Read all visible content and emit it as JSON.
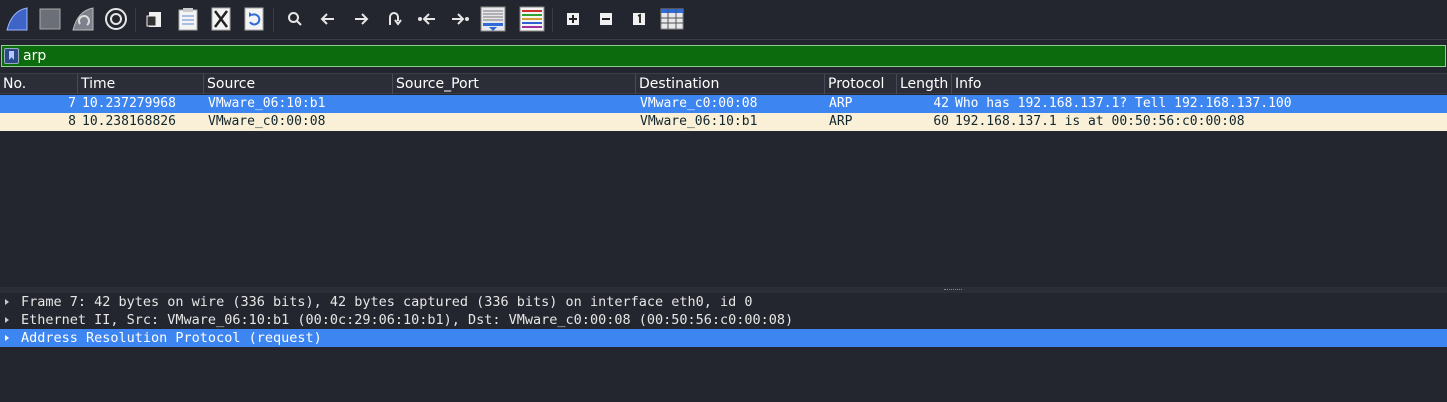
{
  "toolbar": {
    "buttons": [
      {
        "name": "start-capture-icon"
      },
      {
        "name": "stop-capture-icon"
      },
      {
        "name": "restart-capture-icon"
      },
      {
        "name": "capture-options-icon"
      },
      {
        "name": "open-file-icon"
      },
      {
        "name": "save-file-icon"
      },
      {
        "name": "close-file-icon"
      },
      {
        "name": "reload-file-icon"
      },
      {
        "name": "find-packet-icon"
      },
      {
        "name": "go-back-icon"
      },
      {
        "name": "go-forward-icon"
      },
      {
        "name": "go-to-packet-icon"
      },
      {
        "name": "go-first-packet-icon"
      },
      {
        "name": "go-last-packet-icon"
      },
      {
        "name": "autoscroll-icon"
      },
      {
        "name": "colorize-icon"
      },
      {
        "name": "zoom-in-icon"
      },
      {
        "name": "zoom-out-icon"
      },
      {
        "name": "normal-size-icon"
      },
      {
        "name": "resize-columns-icon"
      }
    ]
  },
  "filter": {
    "value": "arp"
  },
  "packet_list": {
    "columns": [
      "No.",
      "Time",
      "Source",
      "Source_Port",
      "Destination",
      "Protocol",
      "Length",
      "Info"
    ],
    "rows": [
      {
        "no": "7",
        "time": "10.237279968",
        "source": "VMware_06:10:b1",
        "source_port": "",
        "destination": "VMware_c0:00:08",
        "protocol": "ARP",
        "length": "42",
        "info": "Who has 192.168.137.1? Tell 192.168.137.100",
        "selected": true
      },
      {
        "no": "8",
        "time": "10.238168826",
        "source": "VMware_c0:00:08",
        "source_port": "",
        "destination": "VMware_06:10:b1",
        "protocol": "ARP",
        "length": "60",
        "info": "192.168.137.1 is at 00:50:56:c0:00:08",
        "selected": false
      }
    ]
  },
  "details": {
    "items": [
      "Frame 7: 42 bytes on wire (336 bits), 42 bytes captured (336 bits) on interface eth0, id 0",
      "Ethernet II, Src: VMware_06:10:b1 (00:0c:29:06:10:b1), Dst: VMware_c0:00:08 (00:50:56:c0:00:08)",
      "Address Resolution Protocol (request)"
    ],
    "selected_index": 2
  },
  "colors": {
    "background": "#23262e",
    "selection": "#3d85f0",
    "arp_row": "#faf0d7",
    "filter_valid": "#0c6b0c"
  }
}
